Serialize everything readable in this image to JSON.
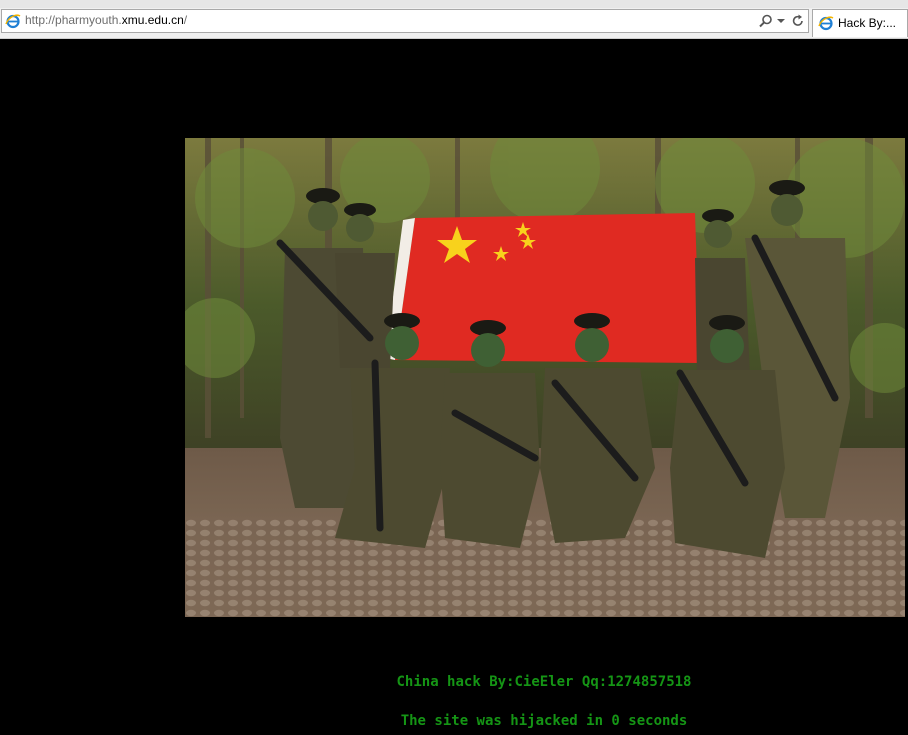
{
  "browser": {
    "url_prefix": "http://pharmyouth.",
    "url_host": "xmu.edu.cn",
    "url_suffix": "/",
    "tab_title": "Hack By:..."
  },
  "page": {
    "line1": "China hack By:CieEler Qq:1274857518",
    "line2": "The site was hijacked in 0 seconds"
  },
  "colors": {
    "background": "#000000",
    "message_text": "#159515",
    "flag_red": "#e02a22",
    "flag_star": "#f8d21c"
  },
  "icons": [
    "ie-logo-icon",
    "search-icon",
    "refresh-icon"
  ]
}
